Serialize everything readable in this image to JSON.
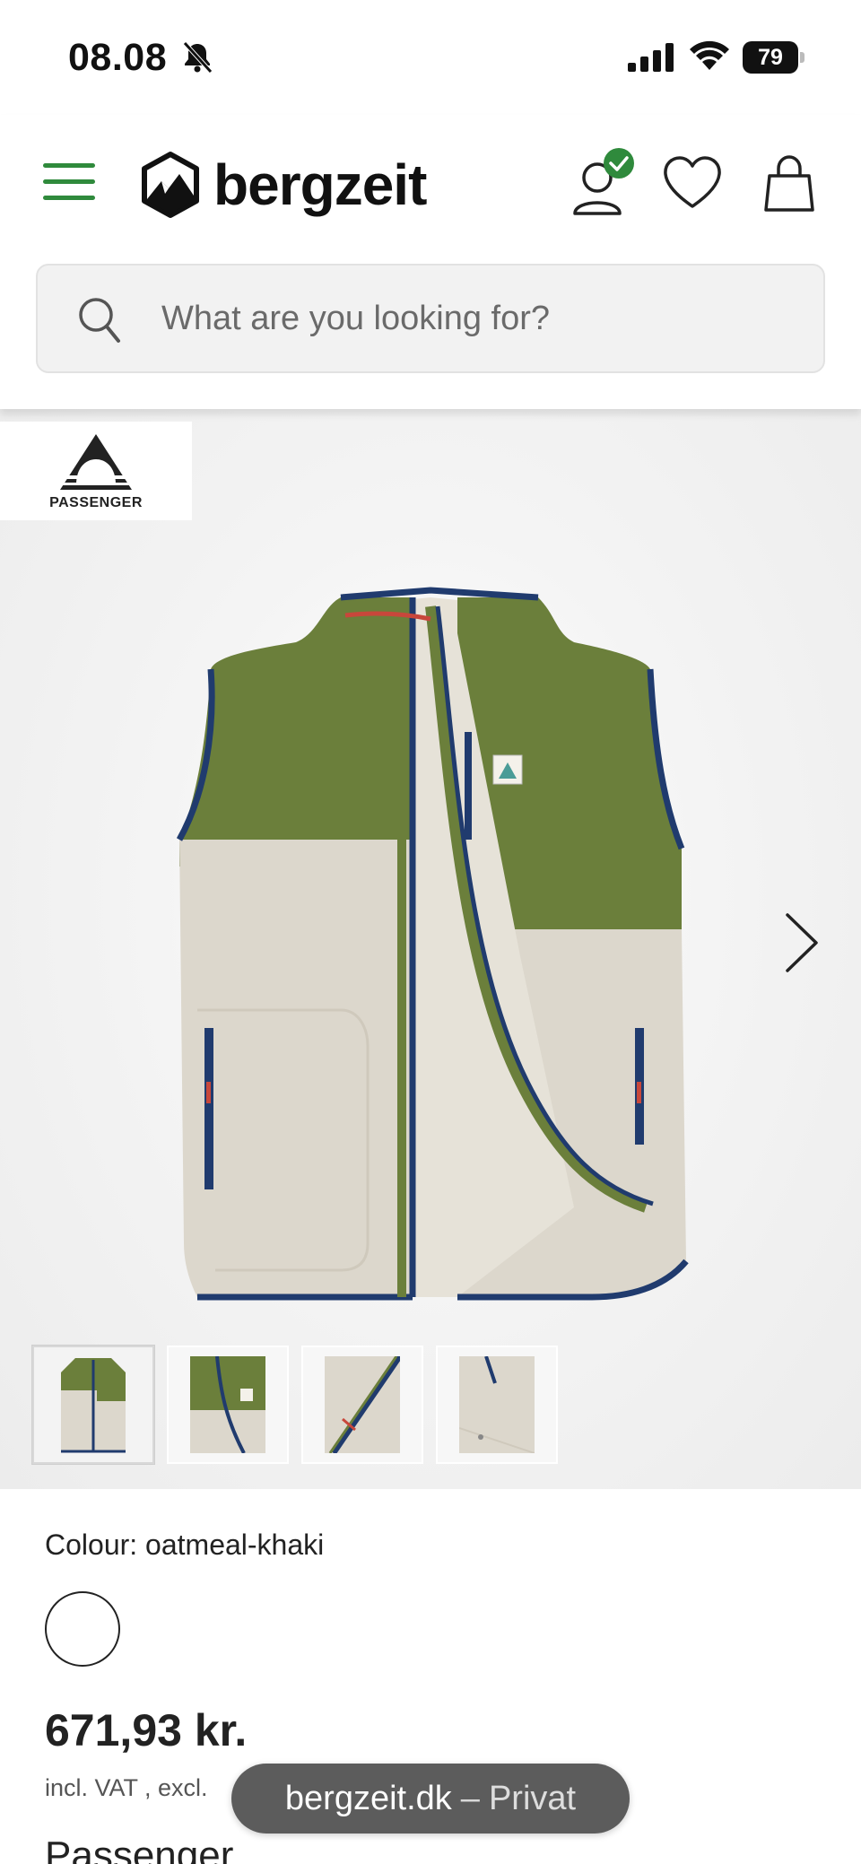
{
  "status_bar": {
    "time": "08.08",
    "battery": "79",
    "icons": [
      "bell-slash-icon",
      "signal-icon",
      "wifi-icon",
      "battery-icon"
    ]
  },
  "header": {
    "logo_text": "bergzeit",
    "icons": [
      "menu-icon",
      "account-icon",
      "heart-icon",
      "bag-icon"
    ],
    "accent_color": "#2f8a3c",
    "search": {
      "placeholder": "What are you looking for?"
    }
  },
  "gallery": {
    "brand_badge": "PASSENGER",
    "thumbnail_count": 4,
    "active_thumbnail": 1
  },
  "product": {
    "colour_label": "Colour: oatmeal-khaki",
    "price": "671,93 kr.",
    "tax_note": "incl. VAT  , excl.",
    "brand": "Passenger"
  },
  "browser": {
    "domain": "bergzeit.dk",
    "separator": "–",
    "mode": "Privat"
  }
}
